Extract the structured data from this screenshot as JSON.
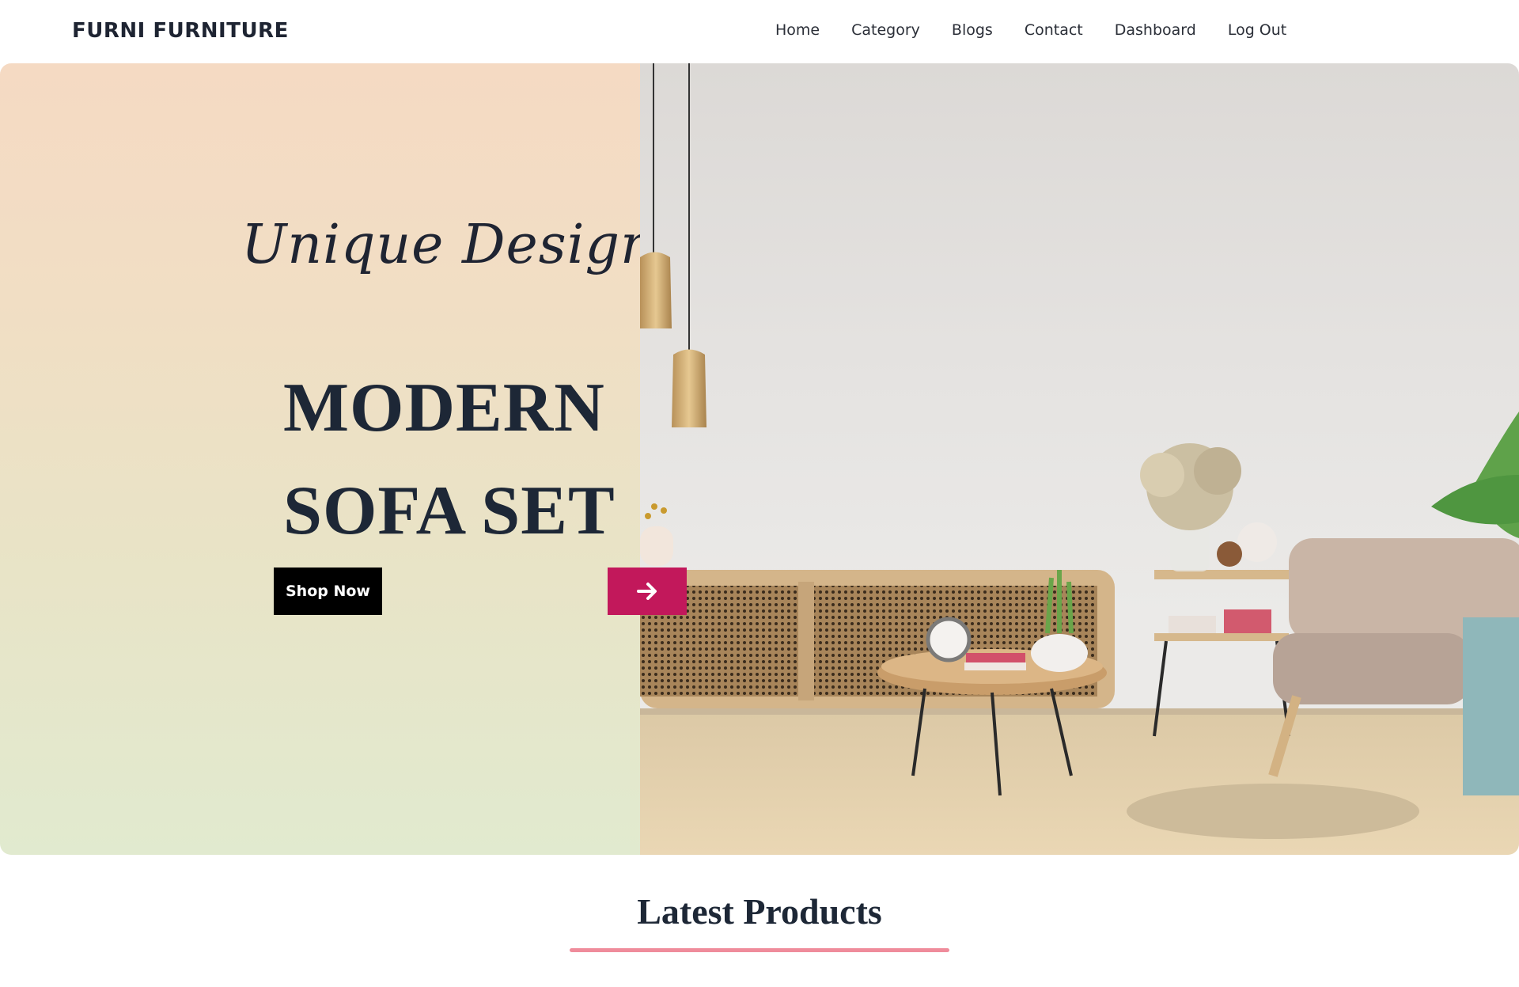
{
  "brand": "FURNI FURNITURE",
  "nav": {
    "items": [
      {
        "label": "Home"
      },
      {
        "label": "Category"
      },
      {
        "label": "Blogs"
      },
      {
        "label": "Contact"
      },
      {
        "label": "Dashboard"
      },
      {
        "label": "Log Out"
      }
    ]
  },
  "hero": {
    "tagline": "Unique Designs",
    "title_line1": "MODERN",
    "title_line2": "SOFA SET",
    "cta_label": "Shop Now",
    "next_icon": "arrow-right-icon",
    "accent_color": "#c2185b"
  },
  "latest": {
    "title": "Latest Products",
    "underline_color": "#ef8c9b"
  }
}
